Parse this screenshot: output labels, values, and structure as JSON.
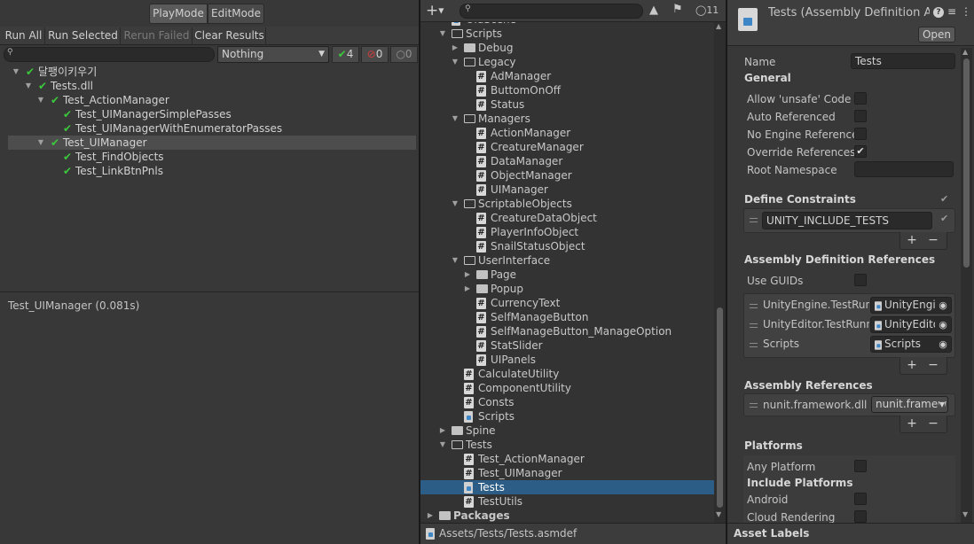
{
  "test_runner": {
    "mode_tabs": [
      "PlayMode",
      "EditMode"
    ],
    "active_mode": "PlayMode",
    "toolbar": {
      "run_all": "Run All",
      "run_selected": "Run Selected",
      "rerun_failed": "Rerun Failed",
      "clear_results": "Clear Results"
    },
    "search": {
      "placeholder": ""
    },
    "filter": {
      "selected": "Nothing"
    },
    "counts": {
      "passed": "4",
      "failed": "0",
      "skipped": "0"
    },
    "tree": [
      {
        "label": "달팽이키우기",
        "depth": 0,
        "expanded": true,
        "status": "passed"
      },
      {
        "label": "Tests.dll",
        "depth": 1,
        "expanded": true,
        "status": "passed"
      },
      {
        "label": "Test_ActionManager",
        "depth": 2,
        "expanded": true,
        "status": "passed"
      },
      {
        "label": "Test_UIManagerSimplePasses",
        "depth": 3,
        "status": "passed"
      },
      {
        "label": "Test_UIManagerWithEnumeratorPasses",
        "depth": 3,
        "status": "passed"
      },
      {
        "label": "Test_UIManager",
        "depth": 2,
        "expanded": true,
        "status": "passed",
        "selected": true
      },
      {
        "label": "Test_FindObjects",
        "depth": 3,
        "status": "passed"
      },
      {
        "label": "Test_LinkBtnPnls",
        "depth": 3,
        "status": "passed"
      }
    ],
    "result_text": "Test_UIManager (0.081s)"
  },
  "project": {
    "add_label": "+",
    "search": {
      "placeholder": ""
    },
    "hidden_count": "11",
    "path": "Assets/Tests/Tests.asmdef",
    "tree": [
      {
        "label": "OldScene",
        "depth": 1,
        "icon": "scene",
        "clipped": true
      },
      {
        "label": "Scripts",
        "depth": 1,
        "icon": "folder-open",
        "arrow": "down"
      },
      {
        "label": "Debug",
        "depth": 2,
        "icon": "folder",
        "arrow": "right"
      },
      {
        "label": "Legacy",
        "depth": 2,
        "icon": "folder-open",
        "arrow": "down"
      },
      {
        "label": "AdManager",
        "depth": 3,
        "icon": "script"
      },
      {
        "label": "ButtomOnOff",
        "depth": 3,
        "icon": "script"
      },
      {
        "label": "Status",
        "depth": 3,
        "icon": "script"
      },
      {
        "label": "Managers",
        "depth": 2,
        "icon": "folder-open",
        "arrow": "down"
      },
      {
        "label": "ActionManager",
        "depth": 3,
        "icon": "script"
      },
      {
        "label": "CreatureManager",
        "depth": 3,
        "icon": "script"
      },
      {
        "label": "DataManager",
        "depth": 3,
        "icon": "script"
      },
      {
        "label": "ObjectManager",
        "depth": 3,
        "icon": "script"
      },
      {
        "label": "UIManager",
        "depth": 3,
        "icon": "script"
      },
      {
        "label": "ScriptableObjects",
        "depth": 2,
        "icon": "folder-open",
        "arrow": "down"
      },
      {
        "label": "CreatureDataObject",
        "depth": 3,
        "icon": "script"
      },
      {
        "label": "PlayerInfoObject",
        "depth": 3,
        "icon": "script"
      },
      {
        "label": "SnailStatusObject",
        "depth": 3,
        "icon": "script"
      },
      {
        "label": "UserInterface",
        "depth": 2,
        "icon": "folder-open",
        "arrow": "down"
      },
      {
        "label": "Page",
        "depth": 3,
        "icon": "folder",
        "arrow": "right"
      },
      {
        "label": "Popup",
        "depth": 3,
        "icon": "folder",
        "arrow": "right"
      },
      {
        "label": "CurrencyText",
        "depth": 3,
        "icon": "script"
      },
      {
        "label": "SelfManageButton",
        "depth": 3,
        "icon": "script"
      },
      {
        "label": "SelfManageButton_ManageOption",
        "depth": 3,
        "icon": "script"
      },
      {
        "label": "StatSlider",
        "depth": 3,
        "icon": "script"
      },
      {
        "label": "UIPanels",
        "depth": 3,
        "icon": "script"
      },
      {
        "label": "CalculateUtility",
        "depth": 2,
        "icon": "script"
      },
      {
        "label": "ComponentUtility",
        "depth": 2,
        "icon": "script"
      },
      {
        "label": "Consts",
        "depth": 2,
        "icon": "script"
      },
      {
        "label": "Scripts",
        "depth": 2,
        "icon": "asmdef"
      },
      {
        "label": "Spine",
        "depth": 1,
        "icon": "folder",
        "arrow": "right"
      },
      {
        "label": "Tests",
        "depth": 1,
        "icon": "folder-open",
        "arrow": "down"
      },
      {
        "label": "Test_ActionManager",
        "depth": 2,
        "icon": "script"
      },
      {
        "label": "Test_UIManager",
        "depth": 2,
        "icon": "script"
      },
      {
        "label": "Tests",
        "depth": 2,
        "icon": "asmdef",
        "selected": true
      },
      {
        "label": "TestUtils",
        "depth": 2,
        "icon": "script"
      },
      {
        "label": "Packages",
        "depth": 0,
        "icon": "folder",
        "arrow": "right",
        "bold": true
      }
    ]
  },
  "inspector": {
    "title": "Tests (Assembly Definition A",
    "open_button": "Open",
    "name_label": "Name",
    "name_value": "Tests",
    "general_header": "General",
    "allow_unsafe": "Allow 'unsafe' Code",
    "auto_referenced": "Auto Referenced",
    "no_engine_refs": "No Engine References",
    "override_refs": "Override References",
    "root_namespace": "Root Namespace",
    "define_constraints_header": "Define Constraints",
    "define_constraint_value": "UNITY_INCLUDE_TESTS",
    "asm_def_refs_header": "Assembly Definition References",
    "use_guids": "Use GUIDs",
    "refs": [
      {
        "label": "UnityEngine.TestRun",
        "value": "UnityEngi"
      },
      {
        "label": "UnityEditor.TestRunn",
        "value": "UnityEdito"
      },
      {
        "label": "Scripts",
        "value": "Scripts"
      }
    ],
    "asm_refs_header": "Assembly References",
    "asm_ref_label": "nunit.framework.dll",
    "asm_ref_value": "nunit.framew",
    "platforms_header": "Platforms",
    "any_platform": "Any Platform",
    "include_platforms": "Include Platforms",
    "android": "Android",
    "cloud_rendering": "Cloud Rendering",
    "asset_labels": "Asset Labels",
    "plus": "+",
    "minus": "−"
  }
}
